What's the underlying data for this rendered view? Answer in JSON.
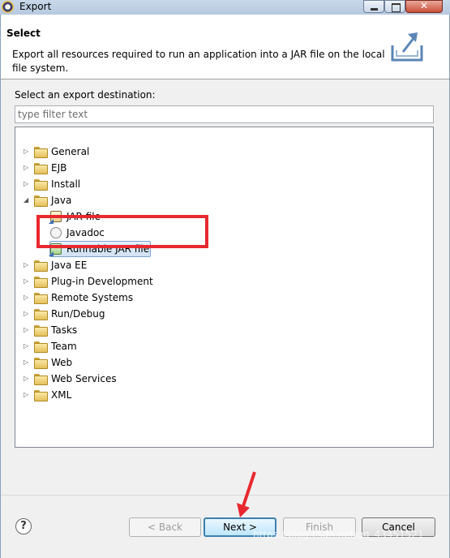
{
  "window": {
    "title": "Export"
  },
  "header": {
    "title": "Select",
    "description": "Export all resources required to run an application into a JAR file on the local file system."
  },
  "destination": {
    "label": "Select an export destination:",
    "filter_placeholder": "type filter text",
    "filter_value": ""
  },
  "tree": {
    "items": [
      {
        "label": "General",
        "expanded": false
      },
      {
        "label": "EJB",
        "expanded": false
      },
      {
        "label": "Install",
        "expanded": false
      },
      {
        "label": "Java",
        "expanded": true,
        "children": [
          {
            "label": "JAR file"
          },
          {
            "label": "Javadoc"
          },
          {
            "label": "Runnable JAR file",
            "selected": true
          }
        ]
      },
      {
        "label": "Java EE",
        "expanded": false
      },
      {
        "label": "Plug-in Development",
        "expanded": false
      },
      {
        "label": "Remote Systems",
        "expanded": false
      },
      {
        "label": "Run/Debug",
        "expanded": false
      },
      {
        "label": "Tasks",
        "expanded": false
      },
      {
        "label": "Team",
        "expanded": false
      },
      {
        "label": "Web",
        "expanded": false
      },
      {
        "label": "Web Services",
        "expanded": false
      },
      {
        "label": "XML",
        "expanded": false
      }
    ]
  },
  "buttons": {
    "back": "< Back",
    "next": "Next >",
    "finish": "Finish",
    "cancel": "Cancel",
    "help": "?"
  },
  "annotation": {
    "highlight_color": "#e8282f"
  },
  "watermark": "https://blog.csdn.net/qq_43451521"
}
